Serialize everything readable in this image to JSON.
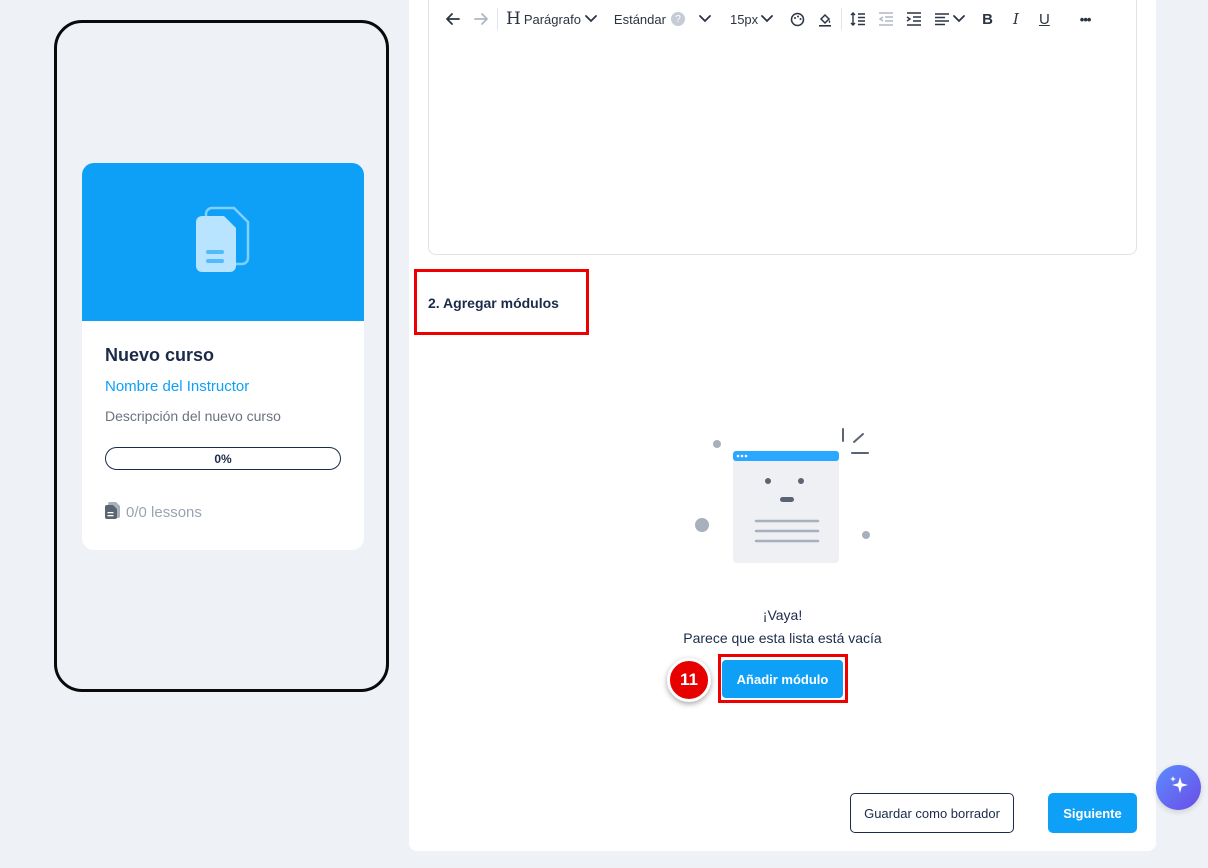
{
  "preview": {
    "course_title": "Nuevo curso",
    "instructor": "Nombre del Instructor",
    "description": "Descripción del nuevo curso",
    "progress_label": "0%",
    "progress_fraction": 0,
    "lessons": "0/0 lessons",
    "banner_color": "#0ea0f7",
    "banner_icon": "documents-icon"
  },
  "toolbar": {
    "heading_label": "Parágrafo",
    "font_label": "Estándar",
    "size_label": "15px",
    "more_label": "•••"
  },
  "modules": {
    "section_title": "2. Agregar módulos",
    "empty_title": "¡Vaya!",
    "empty_message": "Parece que esta lista está vacía",
    "add_button": "Añadir módulo",
    "step_number": "11"
  },
  "footer": {
    "draft_button": "Guardar como borrador",
    "next_button": "Siguiente"
  },
  "colors": {
    "accent": "#0ea0f7",
    "highlight": "#ee0000",
    "text_dark": "#1c2b4a"
  }
}
